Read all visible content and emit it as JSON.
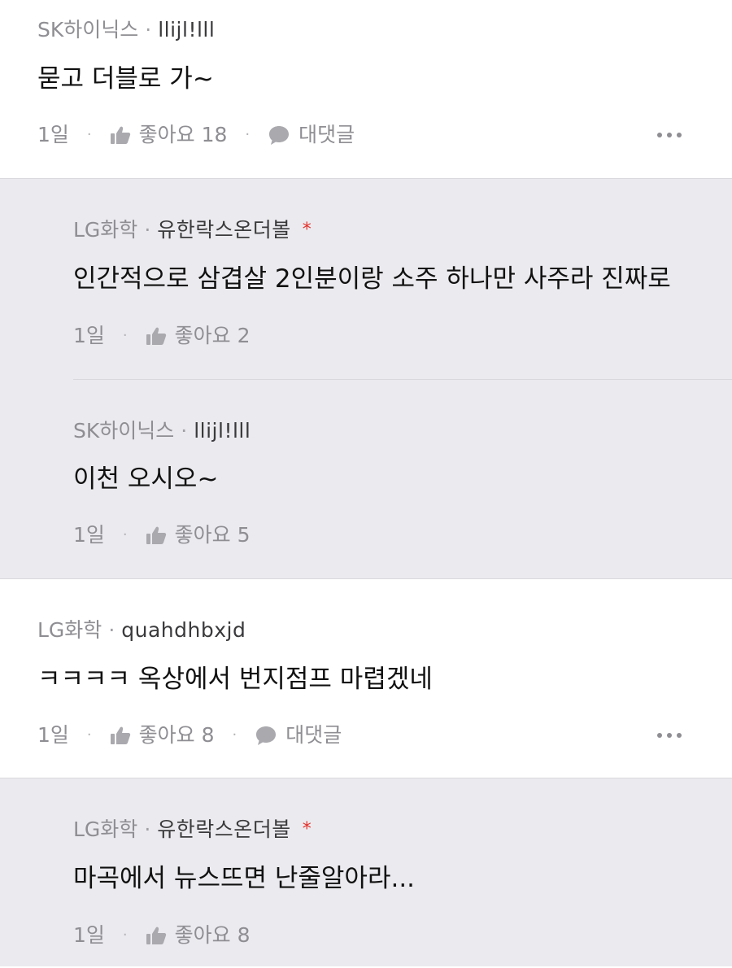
{
  "comments": [
    {
      "group": "SK하이닉스",
      "nickname": "llijl!lll",
      "text": "묻고 더블로 가~",
      "time": "1일",
      "likes_label": "좋아요 18",
      "reply_label": "대댓글"
    },
    {
      "group": "LG화학",
      "nickname": "유한락스온더볼",
      "author_mark": "*",
      "text": "인간적으로 삼겹살 2인분이랑 소주 하나만 사주라 진짜로",
      "time": "1일",
      "likes_label": "좋아요 2"
    },
    {
      "group": "SK하이닉스",
      "nickname": "llijl!lll",
      "text": "이천 오시오~",
      "time": "1일",
      "likes_label": "좋아요 5"
    },
    {
      "group": "LG화학",
      "nickname": "quahdhbxjd",
      "text": "ㅋㅋㅋㅋ 옥상에서 번지점프 마렵겠네",
      "time": "1일",
      "likes_label": "좋아요 8",
      "reply_label": "대댓글"
    },
    {
      "group": "LG화학",
      "nickname": "유한락스온더볼",
      "author_mark": "*",
      "text": "마곡에서 뉴스뜨면 난줄알아라...",
      "time": "1일",
      "likes_label": "좋아요 8"
    }
  ],
  "separator_dot": "·",
  "icons": {
    "like": "thumbs-up-icon",
    "reply": "speech-bubble-icon",
    "more": "more-dots-icon"
  },
  "colors": {
    "reply_background": "#ebebef",
    "secondary_text": "#8e8e93",
    "author_mark": "#e4312b"
  }
}
